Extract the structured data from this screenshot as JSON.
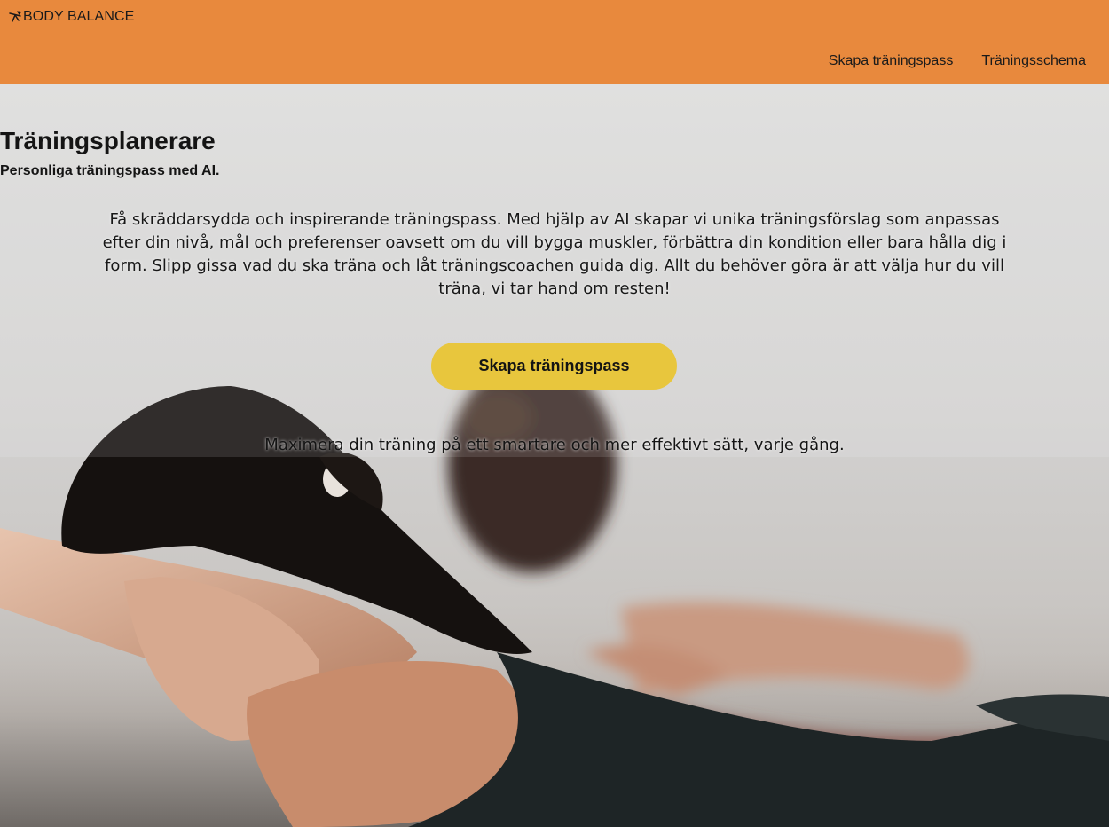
{
  "brand": {
    "name": "BODY BALANCE",
    "icon": "running-figure-icon"
  },
  "nav": {
    "items": [
      {
        "label": "Skapa träningspass"
      },
      {
        "label": "Träningsschema"
      }
    ]
  },
  "hero": {
    "title": "Träningsplanerare",
    "subtitle": "Personliga träningspass med AI.",
    "description": "Få skräddarsydda och inspirerande träningspass. Med hjälp av AI skapar vi unika träningsförslag som anpassas efter din nivå, mål och preferenser oavsett om du vill bygga muskler, förbättra din kondition eller bara hålla dig i form. Slipp gissa vad du ska träna och låt träningscoachen guida dig. Allt du behöver göra är att välja hur du vill träna, vi tar hand om resten!",
    "cta_label": "Skapa träningspass",
    "tagline": "Maximera din träning på ett smartare och mer effektivt sätt, varje gång.",
    "background_image": "two-women-doing-back-exercise-photo"
  },
  "colors": {
    "header_bg": "#e8893d",
    "cta_bg": "#e8c63d",
    "text": "#141414"
  }
}
